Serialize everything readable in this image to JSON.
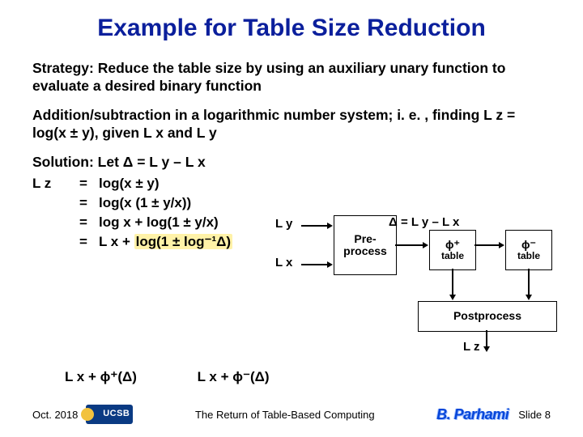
{
  "title": "Example for Table Size Reduction",
  "strategy": "Strategy: Reduce the table size by using an auxiliary unary function to evaluate a desired binary function",
  "problem": "Addition/subtraction in a logarithmic number system; i. e. , finding L z = log(x ± y), given L x and L y",
  "solution_header": "Solution: Let Δ = L y – L x",
  "deriv": {
    "lhs": "L z",
    "eq": "=",
    "line1": "log(x ± y)",
    "line2": "log(x (1 ± y/x))",
    "line3": "log x + log(1 ± y/x)",
    "line4_pre": "L x + ",
    "line4_hl": "log(1 ± log⁻¹Δ)"
  },
  "diagram": {
    "Ly": "L y",
    "Lx": "L x",
    "delta": "Δ = L y – L x",
    "preprocess": "Pre-\nprocess",
    "phi_plus": "ϕ⁺",
    "phi_minus": "ϕ⁻",
    "table": "table",
    "postprocess": "Postprocess",
    "Lz": "L z"
  },
  "outputs": {
    "out1": "L x + ϕ⁺(Δ)",
    "out2": "L x + ϕ⁻(Δ)"
  },
  "footer": {
    "date": "Oct. 2018",
    "center": "The Return of Table-Based Computing",
    "slide": "Slide 8",
    "logo": "UCSB",
    "author": "B. Parhami"
  }
}
